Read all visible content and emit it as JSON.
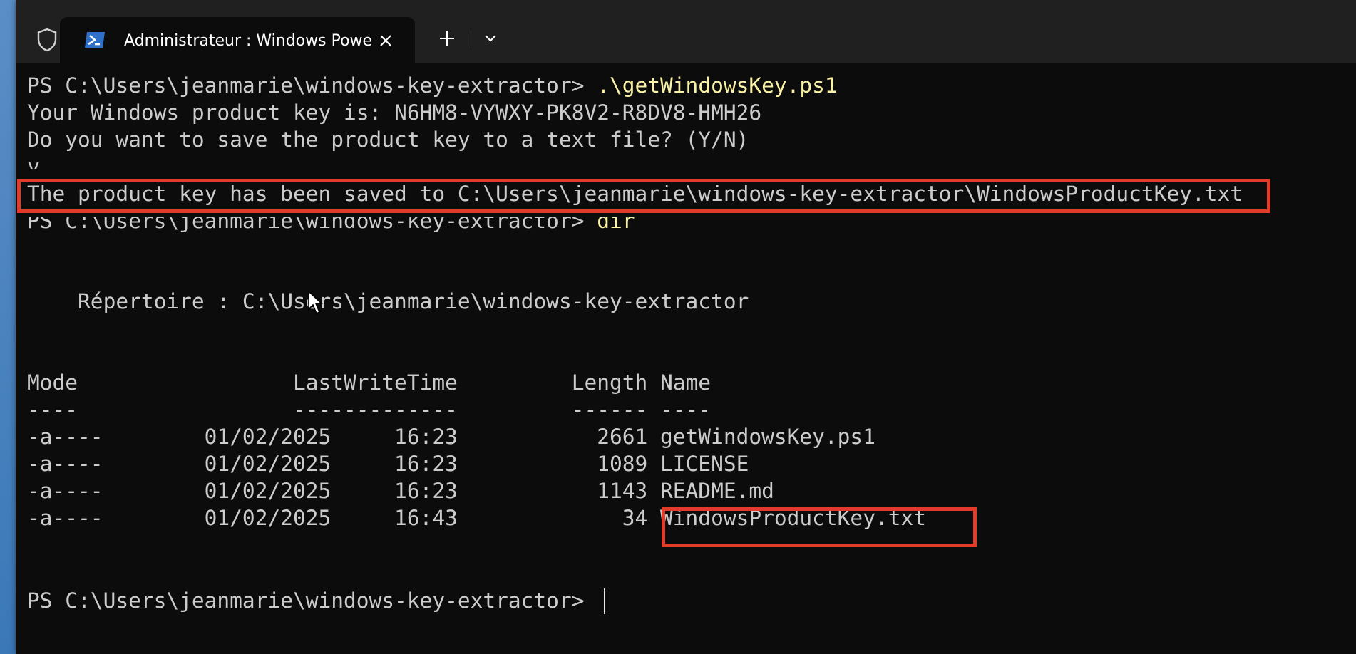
{
  "window": {
    "tab_title": "Administrateur : Windows PowerShell",
    "new_tab_symbol": "+",
    "icons": {
      "shield": "shield-icon",
      "powershell": "powershell-icon",
      "close": "close-icon",
      "new_tab": "plus-icon",
      "dropdown": "chevron-down-icon"
    }
  },
  "terminal": {
    "prompt": "PS C:\\Users\\jeanmarie\\windows-key-extractor> ",
    "lines": {
      "cmd1": ".\\getWindowsKey.ps1",
      "key_line": "Your Windows product key is: N6HM8-VYWXY-PK8V2-R8DV8-HMH26",
      "save_question": "Do you want to save the product key to a text file? (Y/N)",
      "answer": "y",
      "saved_line": "The product key has been saved to C:\\Users\\jeanmarie\\windows-key-extractor\\WindowsProductKey.txt",
      "cmd2": "dir",
      "directory_line": "    Répertoire : C:\\Users\\jeanmarie\\windows-key-extractor"
    },
    "listing": {
      "header": "Mode                 LastWriteTime         Length Name",
      "separator": "----                 -------------         ------ ----",
      "rows": [
        {
          "text": "-a----        01/02/2025     16:23           2661 getWindowsKey.ps1"
        },
        {
          "text": "-a----        01/02/2025     16:23           1089 LICENSE"
        },
        {
          "text": "-a----        01/02/2025     16:23           1143 README.md"
        },
        {
          "text": "-a----        01/02/2025     16:43             34 WindowsProductKey.txt"
        }
      ]
    }
  },
  "colors": {
    "terminal_bg": "#0c0c0c",
    "text": "#cccccc",
    "command": "#f9f1a5",
    "highlight": "#e23b2a",
    "titlebar_bg": "#202020"
  }
}
